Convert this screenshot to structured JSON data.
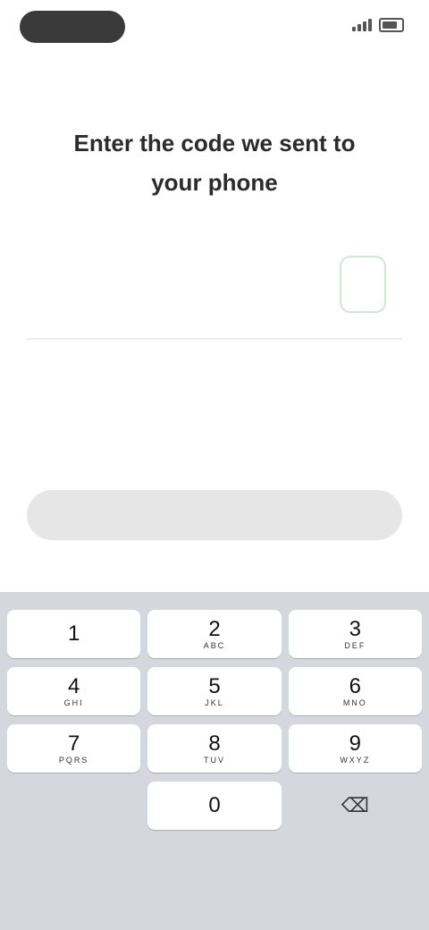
{
  "status_bar": {
    "time": "",
    "signal_bars": 4,
    "battery_level": 0.75
  },
  "header": {
    "title": "Enter the code we sent to\nyour phone"
  },
  "code_input": {
    "digits": [
      "",
      "",
      "",
      "",
      "",
      ""
    ],
    "active_index": 5
  },
  "resend": {
    "label": ""
  },
  "submit": {
    "label": ""
  },
  "keyboard": {
    "keys": [
      {
        "num": "1",
        "letters": ""
      },
      {
        "num": "2",
        "letters": "ABC"
      },
      {
        "num": "3",
        "letters": "DEF"
      },
      {
        "num": "4",
        "letters": "GHI"
      },
      {
        "num": "5",
        "letters": "JKL"
      },
      {
        "num": "6",
        "letters": "MNO"
      },
      {
        "num": "7",
        "letters": "PQRS"
      },
      {
        "num": "8",
        "letters": "TUV"
      },
      {
        "num": "9",
        "letters": "WXYZ"
      },
      {
        "num": "",
        "letters": ""
      },
      {
        "num": "0",
        "letters": ""
      },
      {
        "num": "⌫",
        "letters": ""
      }
    ],
    "delete_icon": "backspace-icon"
  },
  "colors": {
    "accent": "#4caf6e",
    "button_disabled_bg": "#e6e6e6",
    "keyboard_bg": "#d4d7dd"
  }
}
